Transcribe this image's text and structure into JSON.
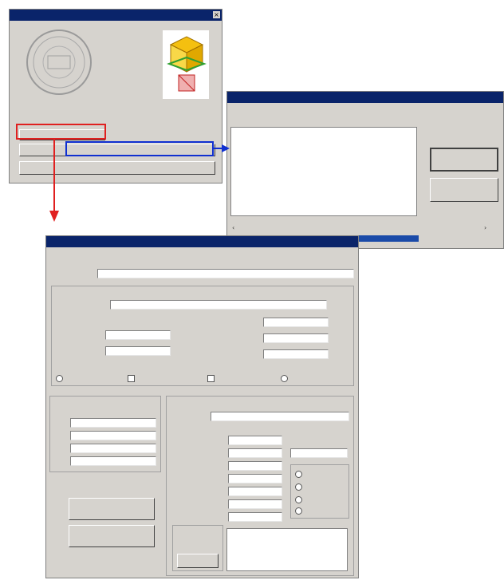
{
  "about_window": {
    "title": "",
    "company_label": "",
    "version_text": "",
    "buttons": {
      "primary_label": "",
      "secondary_label": "",
      "ok_label": ""
    }
  },
  "info_dialog": {
    "title": "",
    "heading": "",
    "subheading": "",
    "text_lines": [
      "",
      "",
      "",
      "",
      "",
      "",
      "",
      "",
      "",
      "",
      "",
      ""
    ],
    "buttons": {
      "ok_label": "",
      "cancel_label": ""
    },
    "status_text": ""
  },
  "config_window": {
    "title": "",
    "header": "",
    "fields": [
      {
        "label": "",
        "value": ""
      },
      {
        "label": "",
        "value": ""
      }
    ],
    "left_pairs": [
      {
        "label": "",
        "value": ""
      },
      {
        "label": "",
        "value": ""
      }
    ],
    "right_pairs": [
      {
        "label": "",
        "value": ""
      },
      {
        "label": "",
        "value": ""
      },
      {
        "label": "",
        "value": ""
      }
    ],
    "options": [
      "",
      "",
      "",
      ""
    ],
    "left_group": {
      "title": "",
      "rows": [
        {
          "label": "",
          "value": ""
        },
        {
          "label": "",
          "value": ""
        },
        {
          "label": "",
          "value": ""
        },
        {
          "label": "",
          "value": ""
        }
      ]
    },
    "right_group": {
      "title": "",
      "top_field": {
        "label": "",
        "value": ""
      },
      "rows": [
        {
          "label": "",
          "value": ""
        },
        {
          "label": "",
          "value": ""
        },
        {
          "label": "",
          "value": ""
        },
        {
          "label": "",
          "value": ""
        },
        {
          "label": "",
          "value": ""
        },
        {
          "label": "",
          "value": ""
        },
        {
          "label": "",
          "value": ""
        }
      ],
      "side_label": "",
      "side_value": "",
      "radio_options": [
        "",
        "",
        "",
        ""
      ],
      "list_items": [
        "",
        "",
        ""
      ],
      "list_button": ""
    },
    "buttons": {
      "ok_label": "",
      "cancel_label": ""
    }
  },
  "colors": {
    "window_face": "#d6d3ce",
    "titlebar": "#0a246a",
    "highlight_red": "#e02020",
    "highlight_blue": "#1030d0"
  },
  "icons": {
    "seal": "seal-emblem-icon",
    "cube": "3d-cube-icon"
  }
}
